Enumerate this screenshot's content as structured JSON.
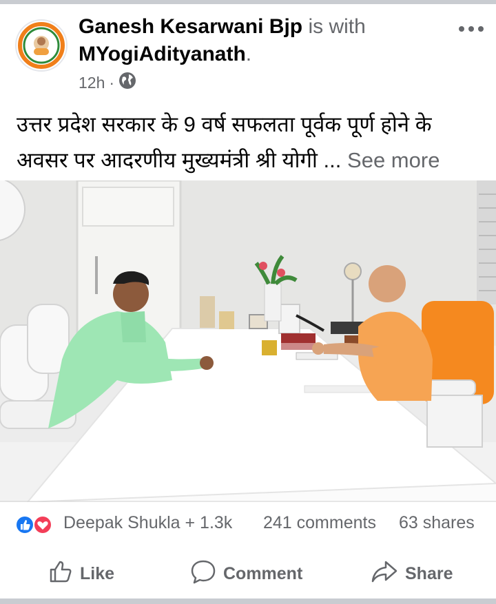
{
  "post": {
    "author": "Ganesh Kesarwani Bjp",
    "with_text": "is with",
    "tagged": "MYogiAdityanath",
    "tagged_suffix": ".",
    "time": "12h",
    "separator": "·",
    "audience_icon": "globe-icon",
    "more_icon": "more-dots-icon",
    "text_line1": "उत्तर प्रदेश सरकार के 9 वर्ष सफलता पूर्वक पूर्ण होने के",
    "text_line2": "अवसर पर आदरणीय मुख्यमंत्री श्री योगी ...",
    "see_more": "See more"
  },
  "reactions": {
    "icons": [
      "like-reaction-icon",
      "love-reaction-icon"
    ],
    "summary": "Deepak Shukla + 1.3k",
    "comments": "241 comments",
    "shares": "63 shares"
  },
  "actions": [
    {
      "label": "Like",
      "icon": "thumbs-up-icon"
    },
    {
      "label": "Comment",
      "icon": "comment-bubble-icon"
    },
    {
      "label": "Share",
      "icon": "share-arrow-icon"
    }
  ],
  "colors": {
    "text_primary": "#050505",
    "text_secondary": "#65676b",
    "like_blue": "#1877f2",
    "love_red": "#f33e58",
    "divider": "#c9ccd1"
  }
}
